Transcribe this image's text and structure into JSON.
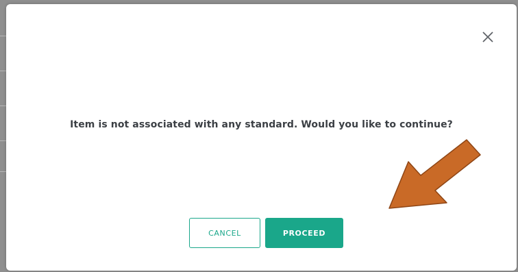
{
  "dialog": {
    "message": "Item is not associated with any standard. Would you like to continue?",
    "cancel_label": "CANCEL",
    "proceed_label": "PROCEED",
    "close_icon": "close-icon"
  },
  "annotation": {
    "arrow_icon": "arrow-icon",
    "arrow_color": "#c96a27"
  },
  "colors": {
    "accent": "#1aa78a",
    "text": "#3b3f44",
    "backdrop": "#8f8f8f"
  }
}
